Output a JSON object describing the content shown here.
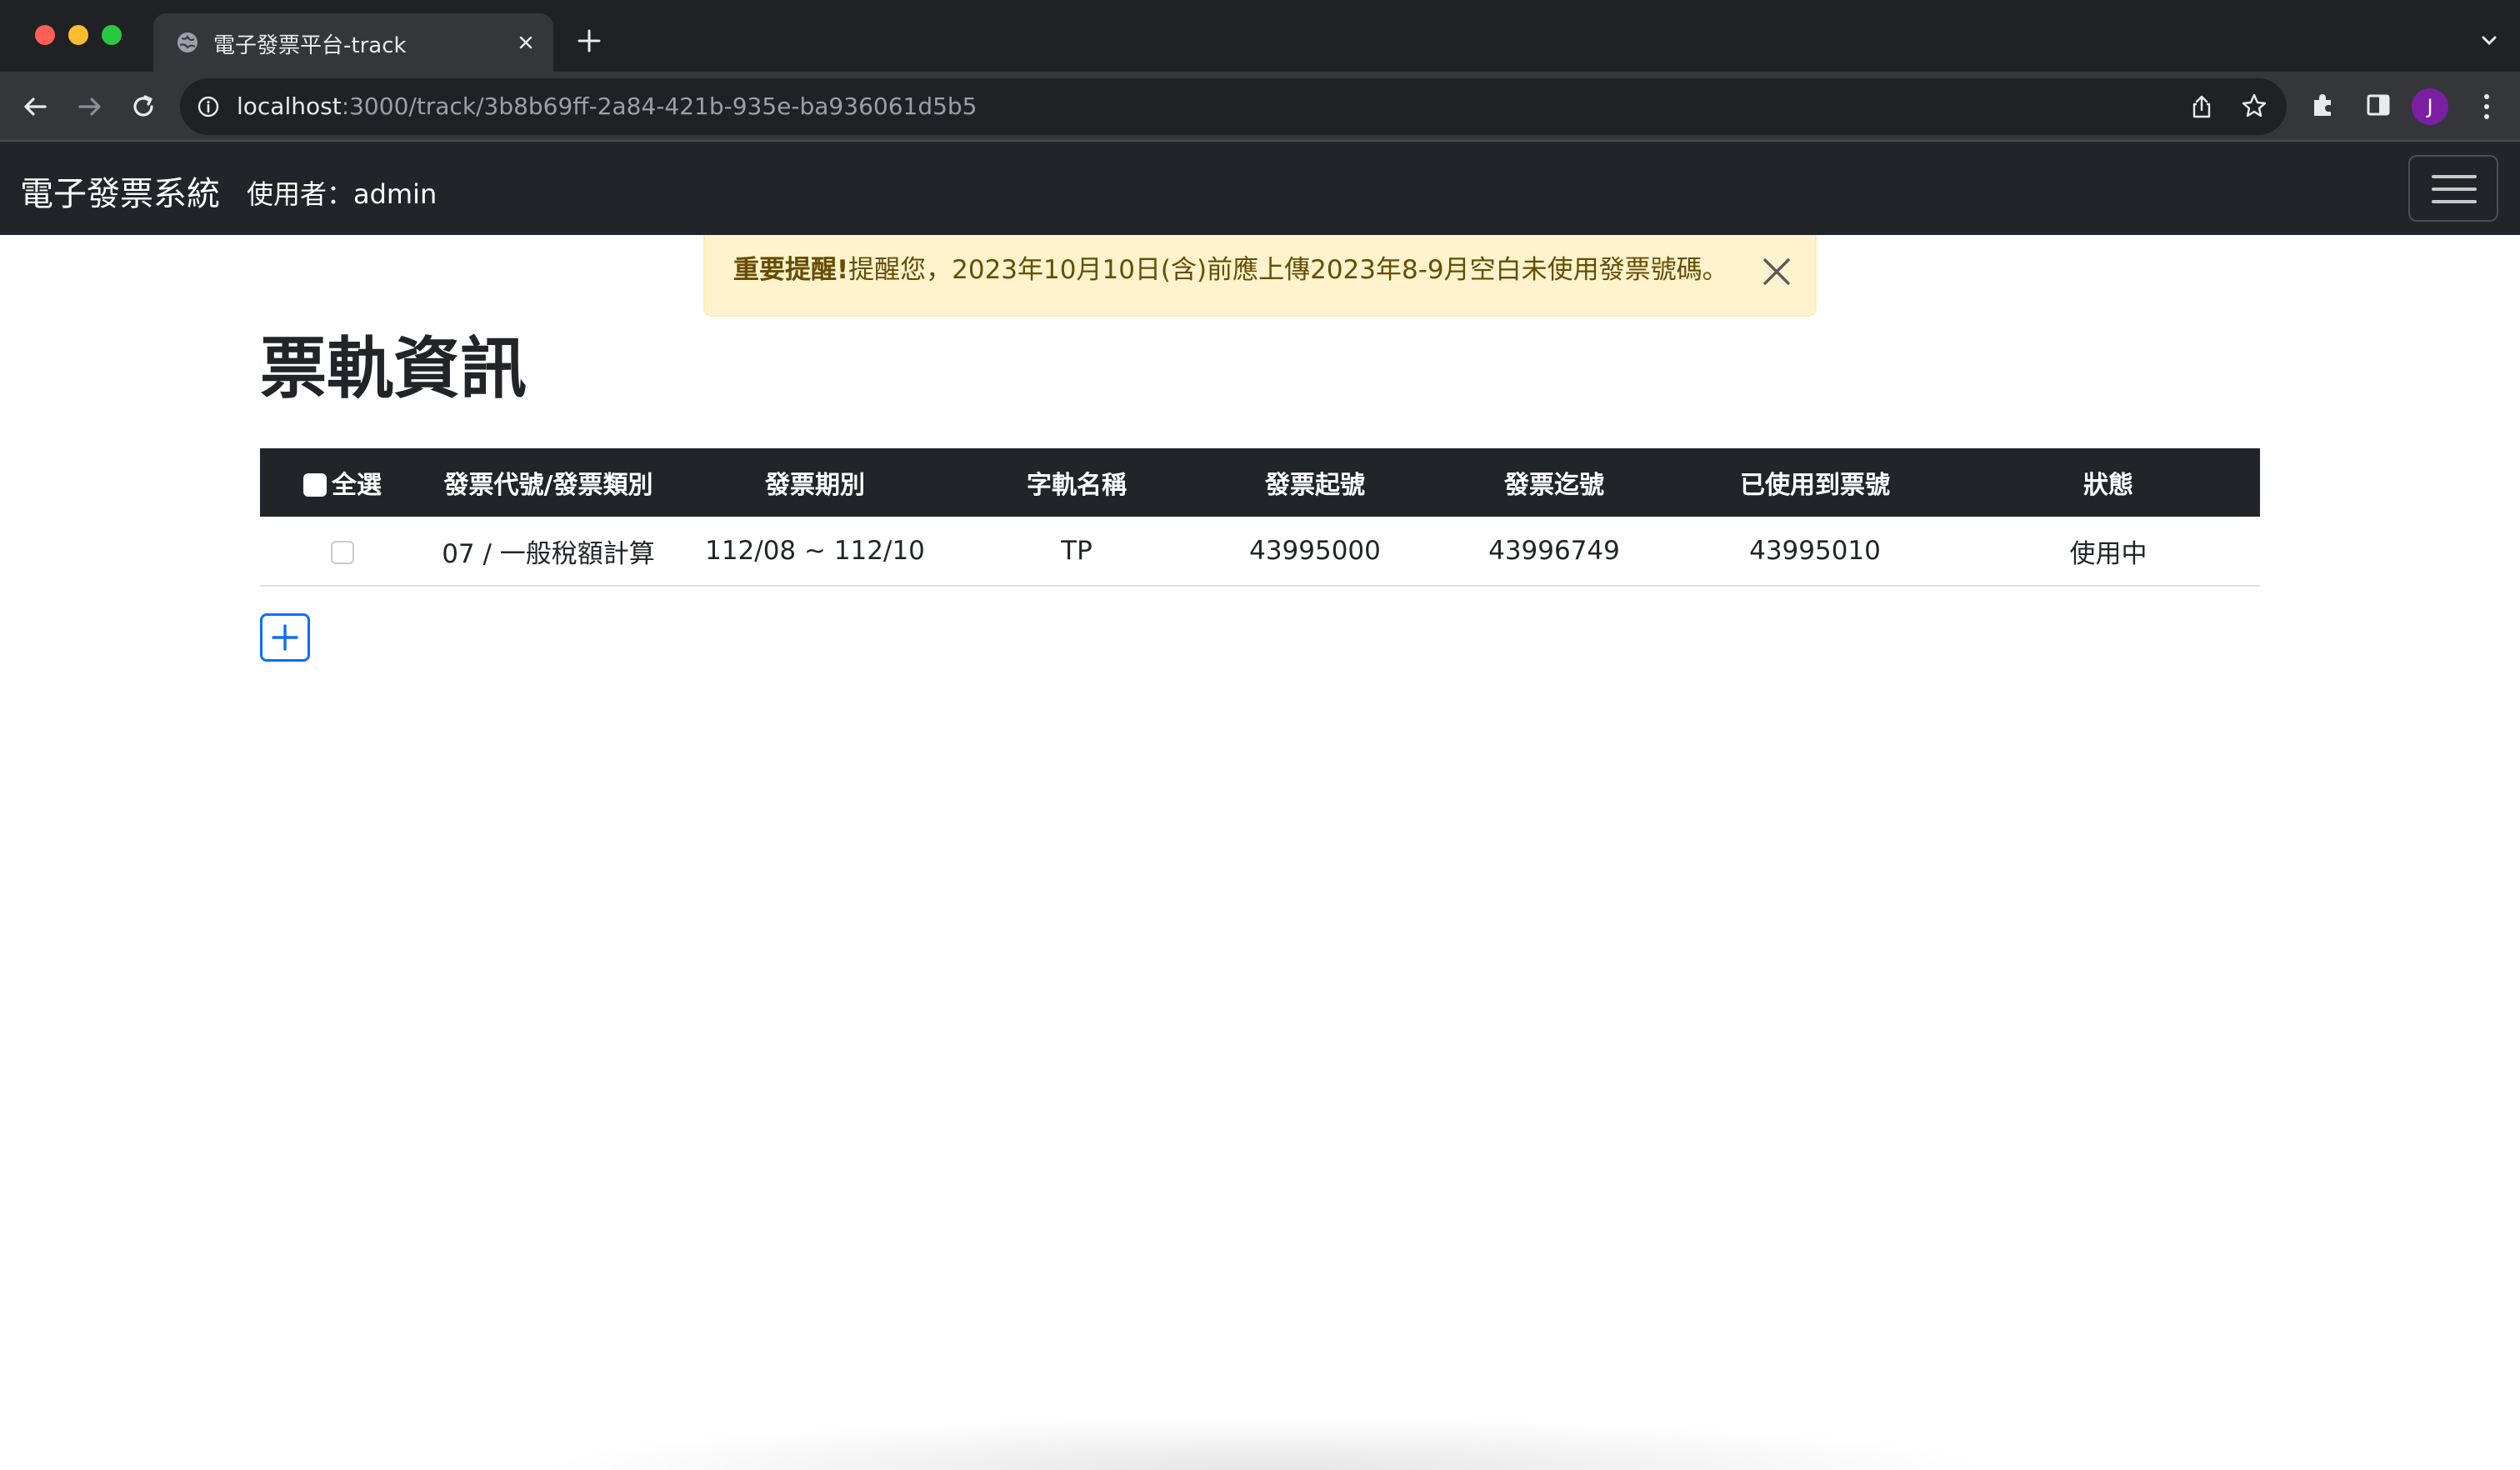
{
  "browser": {
    "tab_title": "電子發票平台-track",
    "url_host": "localhost",
    "url_path": ":3000/track/3b8b69ff-2a84-421b-935e-ba936061d5b5",
    "profile_initial": "J",
    "profile_color": "#7b1fa2"
  },
  "navbar": {
    "brand": "電子發票系統",
    "user_label": "使用者：admin"
  },
  "alert": {
    "strong": "重要提醒!",
    "message": "提醒您，2023年10月10日(含)前應上傳2023年8-9月空白未使用發票號碼。"
  },
  "page": {
    "title": "票軌資訊"
  },
  "table": {
    "select_all_label": "全選",
    "columns": [
      "發票代號/發票類別",
      "發票期別",
      "字軌名稱",
      "發票起號",
      "發票迄號",
      "已使用到票號",
      "狀態"
    ],
    "rows": [
      {
        "checked": false,
        "code_type": "07 / 一般稅額計算",
        "period": "112/08 ~ 112/10",
        "track_name": "TP",
        "start_no": "43995000",
        "end_no": "43996749",
        "used_to": "43995010",
        "status": "使用中"
      }
    ]
  },
  "colors": {
    "navbar_bg": "#212529",
    "alert_bg": "#fff3cd",
    "alert_text": "#664d03",
    "primary": "#0d6efd"
  }
}
